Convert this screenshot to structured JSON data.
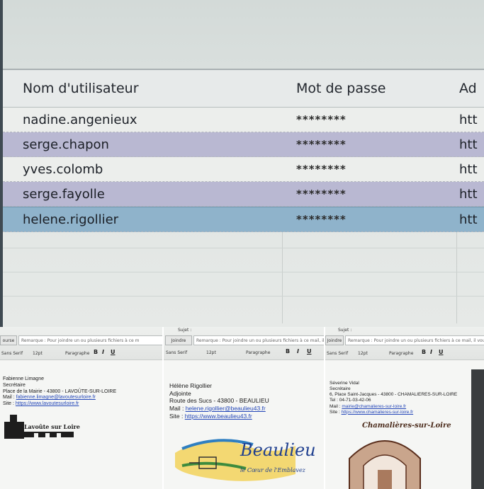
{
  "pw_table": {
    "headers": {
      "user": "Nom d'utilisateur",
      "password": "Mot de passe",
      "address": "Ad"
    },
    "rows": [
      {
        "user": "nadine.angenieux",
        "password": "********",
        "address": "htt",
        "style": "white"
      },
      {
        "user": "serge.chapon",
        "password": "********",
        "address": "htt",
        "style": "lavender"
      },
      {
        "user": "yves.colomb",
        "password": "********",
        "address": "htt",
        "style": "white"
      },
      {
        "user": "serge.fayolle",
        "password": "********",
        "address": "htt",
        "style": "lavender"
      },
      {
        "user": "helene.rigollier",
        "password": "********",
        "address": "htt",
        "style": "selected"
      }
    ]
  },
  "sig1": {
    "toolbar": {
      "field": "Remarque : Pour joindre un ou plusieurs fichiers à ce m",
      "attach": "ourse",
      "font": "Sans Serif",
      "size": "12pt",
      "style": "Paragraphe"
    },
    "name": "Fabienne Limagne",
    "role": "Secrétaire",
    "address": "Place de la Mairie - 43800 - LAVOÛTE-SUR-LOIRE",
    "mail_label": "Mail :",
    "mail": "fabienne.limagne@lavoutesurloire.fr",
    "site_label": "Site :",
    "site": "https://www.lavoutesurloire.fr",
    "logo": "Lavoûte sur Loire"
  },
  "sig2": {
    "toolbar": {
      "subject": "Sujet :",
      "attach": "Joindre",
      "field": "Remarque : Pour joindre un ou plusieurs fichiers à ce mail, il vous",
      "font": "Sans Serif",
      "size": "12pt",
      "style": "Paragraphe"
    },
    "name": "Hélène Rigollier",
    "role": "Adjointe",
    "address": "Route des Sucs - 43800 - BEAULIEU",
    "mail_label": "Mail :",
    "mail": "helene.rigollier@beaulieu43.fr",
    "site_label": "Site :",
    "site": "https://www.beaulieu43.fr",
    "logo": "Beaulieu",
    "tagline": "le Cœur de l'Emblavez"
  },
  "sig3": {
    "toolbar": {
      "subject": "Sujet :",
      "attach": "Joindre",
      "field": "Remarque : Pour joindre un ou plusieurs fichiers à ce mail, il vous suffit de les faire glisse",
      "font": "Sans Serif",
      "size": "12pt",
      "style": "Paragraphe"
    },
    "name": "Séverine Vidal",
    "role": "Secrétaire",
    "address": "6, Place Saint-Jacques - 43800 - CHAMALIERES-SUR-LOIRE",
    "phone": "Tel : 04-71-03-42-06",
    "mail_label": "Mail :",
    "mail": "mairie@chamalieres-sur-loire.fr",
    "site_label": "Site :",
    "site": "https://www.chamalieres-sur-loire.fr",
    "logo": "Chamalières-sur-Loire"
  },
  "colors": {
    "lavender_row": "#b9b8d2",
    "selected_row": "#8fb3cb",
    "link": "#2346b8"
  }
}
